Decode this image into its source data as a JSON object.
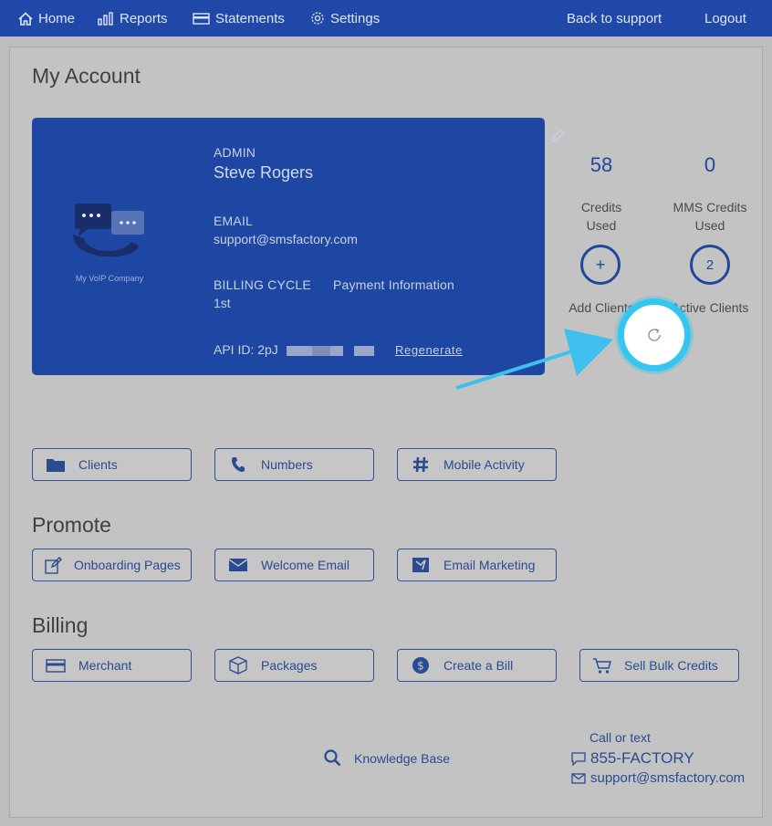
{
  "nav": {
    "home": "Home",
    "reports": "Reports",
    "statements": "Statements",
    "settings": "Settings",
    "back_to_support": "Back to support",
    "logout": "Logout"
  },
  "page_title": "My Account",
  "card": {
    "company_name": "My VoIP Company",
    "role_label": "ADMIN",
    "user_name": "Steve Rogers",
    "email_label": "EMAIL",
    "email_value": "support@smsfactory.com",
    "billing_cycle_label": "BILLING CYCLE",
    "billing_cycle_value": "1st",
    "payment_info_label": "Payment Information",
    "api_id_prefix": "API ID: 2pJ",
    "regenerate_label": "Regenerate"
  },
  "stats": {
    "credits_used_value": "58",
    "credits_used_label_1": "Credits",
    "credits_used_label_2": "Used",
    "mms_credits_value": "0",
    "mms_credits_label_1": "MMS Credits",
    "mms_credits_label_2": "Used",
    "add_clients_symbol": "+",
    "add_clients_label": "Add Clients",
    "active_clients_value": "2",
    "active_clients_label": "Active Clients"
  },
  "actions": {
    "clients": "Clients",
    "numbers": "Numbers",
    "mobile_activity": "Mobile Activity"
  },
  "promote": {
    "heading": "Promote",
    "onboarding_pages": "Onboarding Pages",
    "welcome_email": "Welcome Email",
    "email_marketing": "Email Marketing"
  },
  "billing": {
    "heading": "Billing",
    "merchant": "Merchant",
    "packages": "Packages",
    "create_bill": "Create a Bill",
    "sell_bulk_credits": "Sell Bulk Credits"
  },
  "footer": {
    "knowledge_base": "Knowledge Base",
    "call_or_text": "Call or text",
    "phone": "855-FACTORY",
    "email": "support@smsfactory.com"
  },
  "colors": {
    "nav_bg": "#1f48a8",
    "card_bg": "#1e47a3",
    "accent": "#21479c",
    "highlight_ring": "#35c6f0"
  }
}
